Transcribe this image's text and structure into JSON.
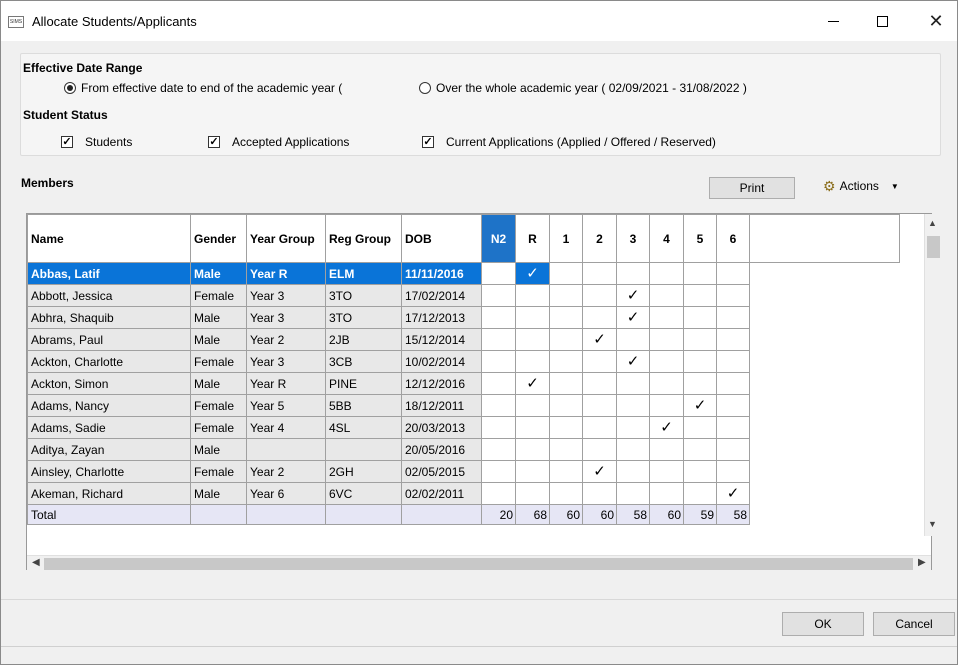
{
  "window": {
    "app_icon_text": "SIMS",
    "title": "Allocate Students/Applicants"
  },
  "date_range": {
    "heading": "Effective Date Range",
    "option_from": "From effective date to end of the academic year (",
    "option_whole": "Over the whole academic year ( 02/09/2021 - 31/08/2022 )",
    "selected": "from"
  },
  "student_status": {
    "heading": "Student Status",
    "students": "Students",
    "accepted": "Accepted Applications",
    "current": "Current Applications (Applied / Offered / Reserved)"
  },
  "members": {
    "heading": "Members",
    "print_label": "Print",
    "actions_label": "Actions"
  },
  "grid": {
    "headers": [
      "Name",
      "Gender",
      "Year Group",
      "Reg Group",
      "DOB",
      "N2",
      "R",
      "1",
      "2",
      "3",
      "4",
      "5",
      "6"
    ],
    "rows": [
      {
        "name": "Abbas, Latif",
        "gender": "Male",
        "year": "Year R",
        "reg": "ELM",
        "dob": "11/11/2016",
        "col": "R"
      },
      {
        "name": "Abbott, Jessica",
        "gender": "Female",
        "year": "Year 3",
        "reg": "3TO",
        "dob": "17/02/2014",
        "col": "3"
      },
      {
        "name": "Abhra, Shaquib",
        "gender": "Male",
        "year": "Year 3",
        "reg": "3TO",
        "dob": "17/12/2013",
        "col": "3"
      },
      {
        "name": "Abrams, Paul",
        "gender": "Male",
        "year": "Year 2",
        "reg": "2JB",
        "dob": "15/12/2014",
        "col": "2"
      },
      {
        "name": "Ackton, Charlotte",
        "gender": "Female",
        "year": "Year 3",
        "reg": "3CB",
        "dob": "10/02/2014",
        "col": "3"
      },
      {
        "name": "Ackton, Simon",
        "gender": "Male",
        "year": "Year R",
        "reg": "PINE",
        "dob": "12/12/2016",
        "col": "R"
      },
      {
        "name": "Adams, Nancy",
        "gender": "Female",
        "year": "Year 5",
        "reg": "5BB",
        "dob": "18/12/2011",
        "col": "5"
      },
      {
        "name": "Adams, Sadie",
        "gender": "Female",
        "year": "Year 4",
        "reg": "4SL",
        "dob": "20/03/2013",
        "col": "4"
      },
      {
        "name": "Aditya, Zayan",
        "gender": "Male",
        "year": "",
        "reg": "",
        "dob": "20/05/2016",
        "col": ""
      },
      {
        "name": "Ainsley, Charlotte",
        "gender": "Female",
        "year": "Year 2",
        "reg": "2GH",
        "dob": "02/05/2015",
        "col": "2"
      },
      {
        "name": "Akeman, Richard",
        "gender": "Male",
        "year": "Year 6",
        "reg": "6VC",
        "dob": "02/02/2011",
        "col": "6"
      }
    ],
    "check_glyph": "✓",
    "total_label": "Total",
    "totals": [
      "20",
      "68",
      "60",
      "60",
      "58",
      "60",
      "59",
      "58"
    ],
    "selected_row": 0
  },
  "scroll": {
    "up": "▲",
    "down": "▼",
    "left": "◀",
    "right": "▶"
  },
  "buttons": {
    "ok": "OK",
    "cancel": "Cancel"
  },
  "icons": {
    "actions": "gear-icon",
    "caret": "▼"
  }
}
